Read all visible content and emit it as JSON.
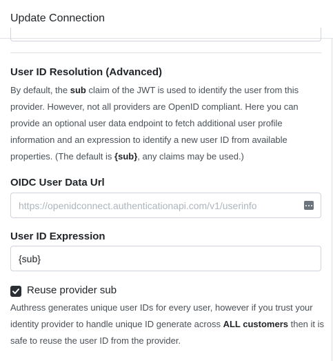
{
  "dialog": {
    "title": "Update Connection"
  },
  "resolution": {
    "title": "User ID Resolution (Advanced)",
    "desc_1": "By default, the ",
    "desc_sub": "sub",
    "desc_2": " claim of the JWT is used to identify the user from this provider. However, not all providers are OpenID compliant. Here you can provide an optional user data endpoint to fetch additional user profile information and an expression to identify a new user ID from available properties. (The default is ",
    "desc_default": "{sub}",
    "desc_3": ", any claims may be used.)"
  },
  "oidc_url": {
    "label": "OIDC User Data Url",
    "value": "",
    "placeholder": "https://openidconnect.authenticationapi.com/v1/userinfo",
    "icon": "more-dots-icon"
  },
  "expression": {
    "label": "User ID Expression",
    "value": "{sub}"
  },
  "reuse_sub": {
    "label": "Reuse provider sub",
    "checked": true,
    "note_1": "Authress generates unique user IDs for every user, however if you trust your identity provider to handle unique ID generate across ",
    "note_bold": "ALL customers",
    "note_2": " then it is safe to reuse the user ID from the provider."
  },
  "colors": {
    "checkbox": "#2b2f33",
    "border": "#ced4da",
    "divider": "#dee2e6"
  }
}
